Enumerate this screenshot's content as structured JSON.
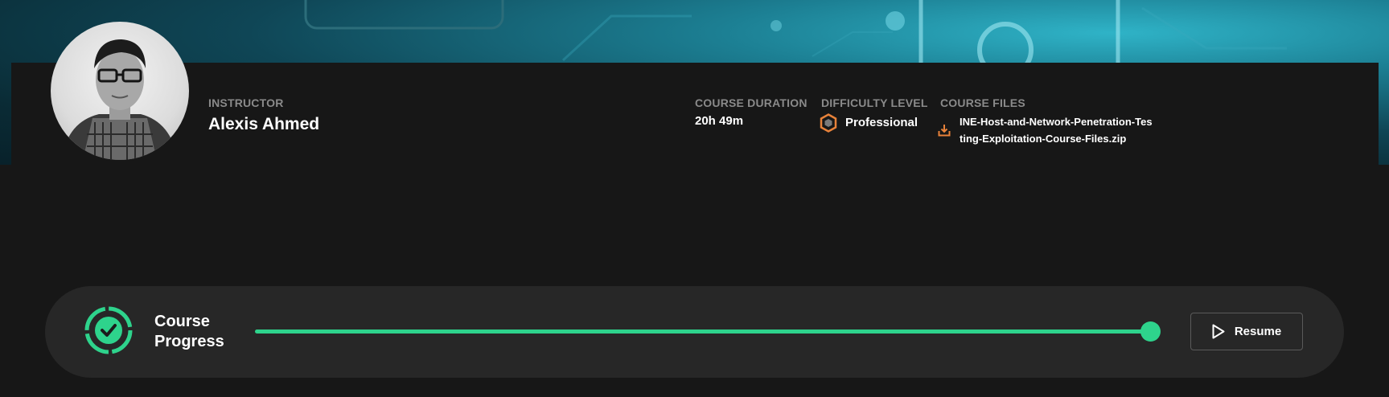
{
  "instructor": {
    "label": "INSTRUCTOR",
    "name": "Alexis Ahmed"
  },
  "course_duration": {
    "label": "COURSE DURATION",
    "value": "20h 49m"
  },
  "difficulty": {
    "label": "DIFFICULTY LEVEL",
    "value": "Professional",
    "icon": "hexagon-icon"
  },
  "course_files": {
    "label": "COURSE FILES",
    "file_name": "INE-Host-and-Network-Penetration-Testing-Exploitation-Course-Files.zip",
    "icon": "download-icon"
  },
  "progress": {
    "title": "Course Progress",
    "percent": 100,
    "icon": "progress-check-icon"
  },
  "resume_button": {
    "label": "Resume",
    "icon": "play-icon"
  },
  "colors": {
    "accent": "#2ed38c",
    "difficulty_icon": "#e8823a",
    "download_icon": "#e8823a"
  }
}
